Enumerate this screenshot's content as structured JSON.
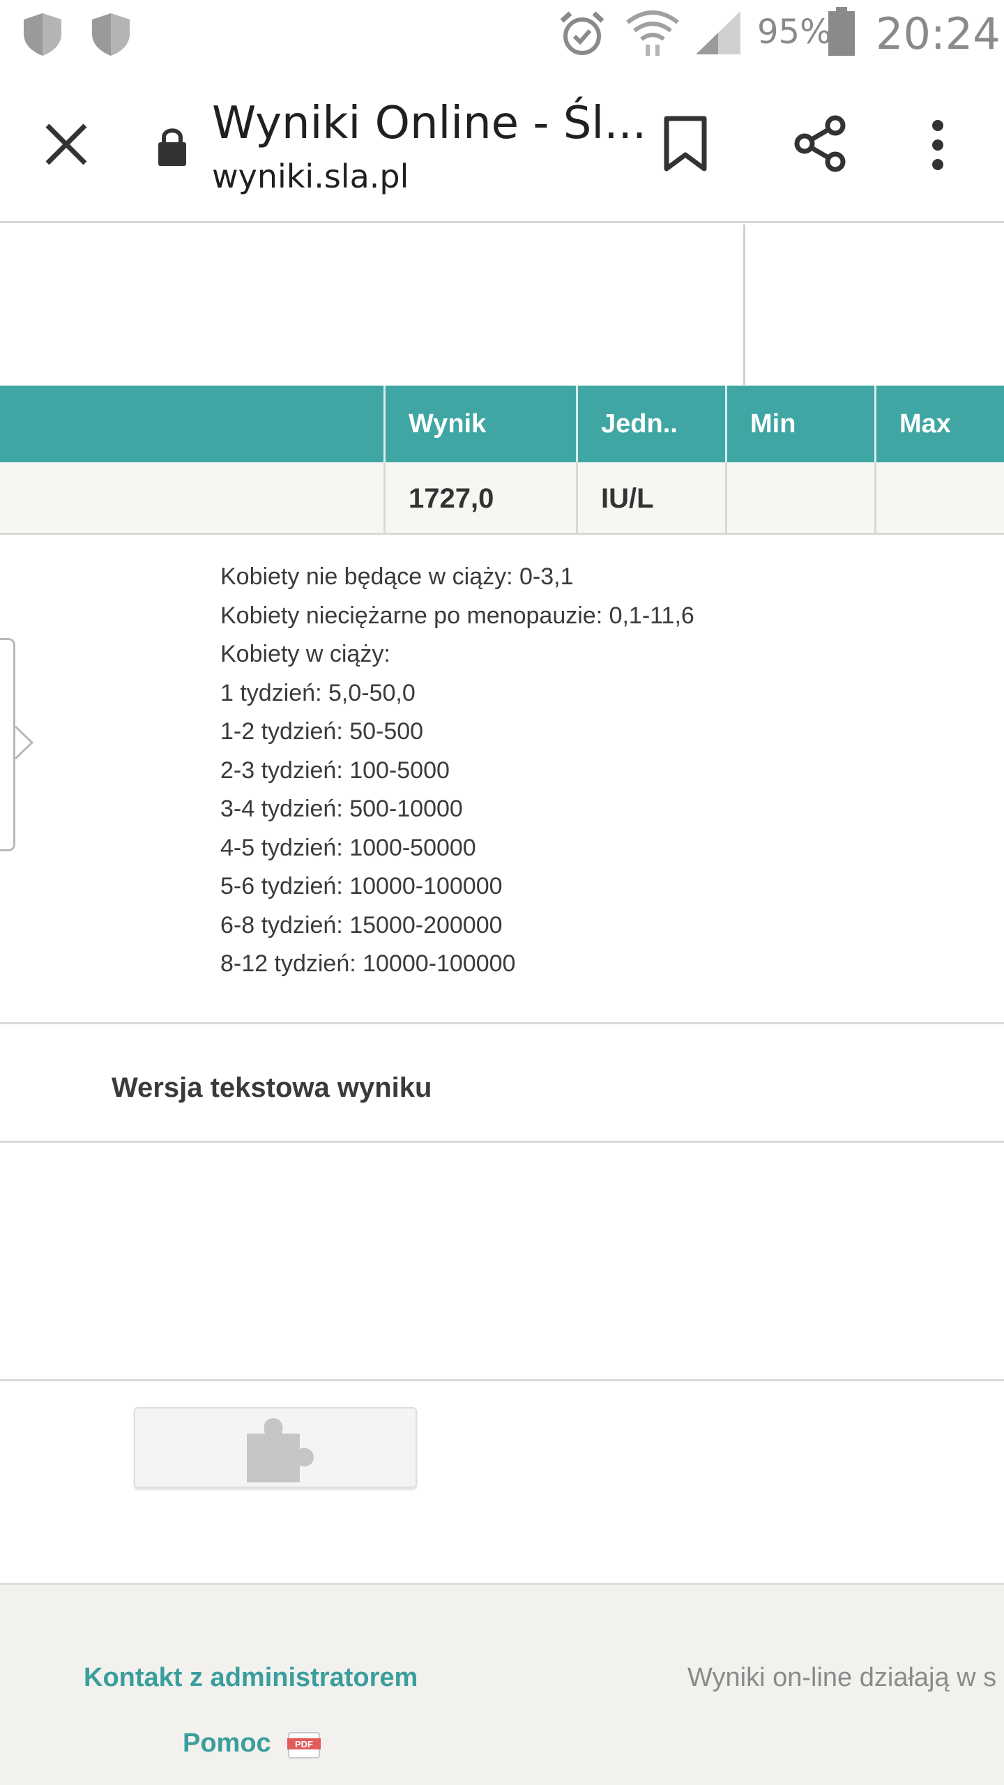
{
  "status_bar": {
    "battery_percent": "95%",
    "time": "20:24"
  },
  "browser": {
    "page_title": "Wyniki Online - Śl...",
    "url": "wyniki.sla.pl",
    "icons": [
      "close-icon",
      "lock-icon",
      "bookmark-icon",
      "share-icon",
      "more-vert-icon"
    ]
  },
  "results_table": {
    "columns": [
      "Wynik",
      "Jedn..",
      "Min",
      "Max"
    ],
    "row": {
      "result": "1727,0",
      "unit": "IU/L",
      "min": "",
      "max": ""
    }
  },
  "reference_ranges": [
    "Kobiety nie będące w ciąży: 0-3,1",
    "Kobiety nieciężarne po menopauzie: 0,1-11,6",
    "Kobiety w ciąży:",
    "1 tydzień: 5,0-50,0",
    "1-2 tydzień: 50-500",
    "2-3 tydzień: 100-5000",
    "3-4 tydzień: 500-10000",
    "4-5 tydzień: 1000-50000",
    "5-6 tydzień: 10000-100000",
    "6-8 tydzień: 15000-200000",
    "8-12 tydzień: 10000-100000"
  ],
  "text_version_label": "Wersja tekstowa wyniku",
  "footer": {
    "contact_label": "Kontakt z administratorem",
    "help_label": "Pomoc",
    "pdf_badge": "PDF",
    "note": "Wyniki on-line działają w s"
  },
  "colors": {
    "accent": "#3fa6a4",
    "link": "#3a9e9c"
  }
}
